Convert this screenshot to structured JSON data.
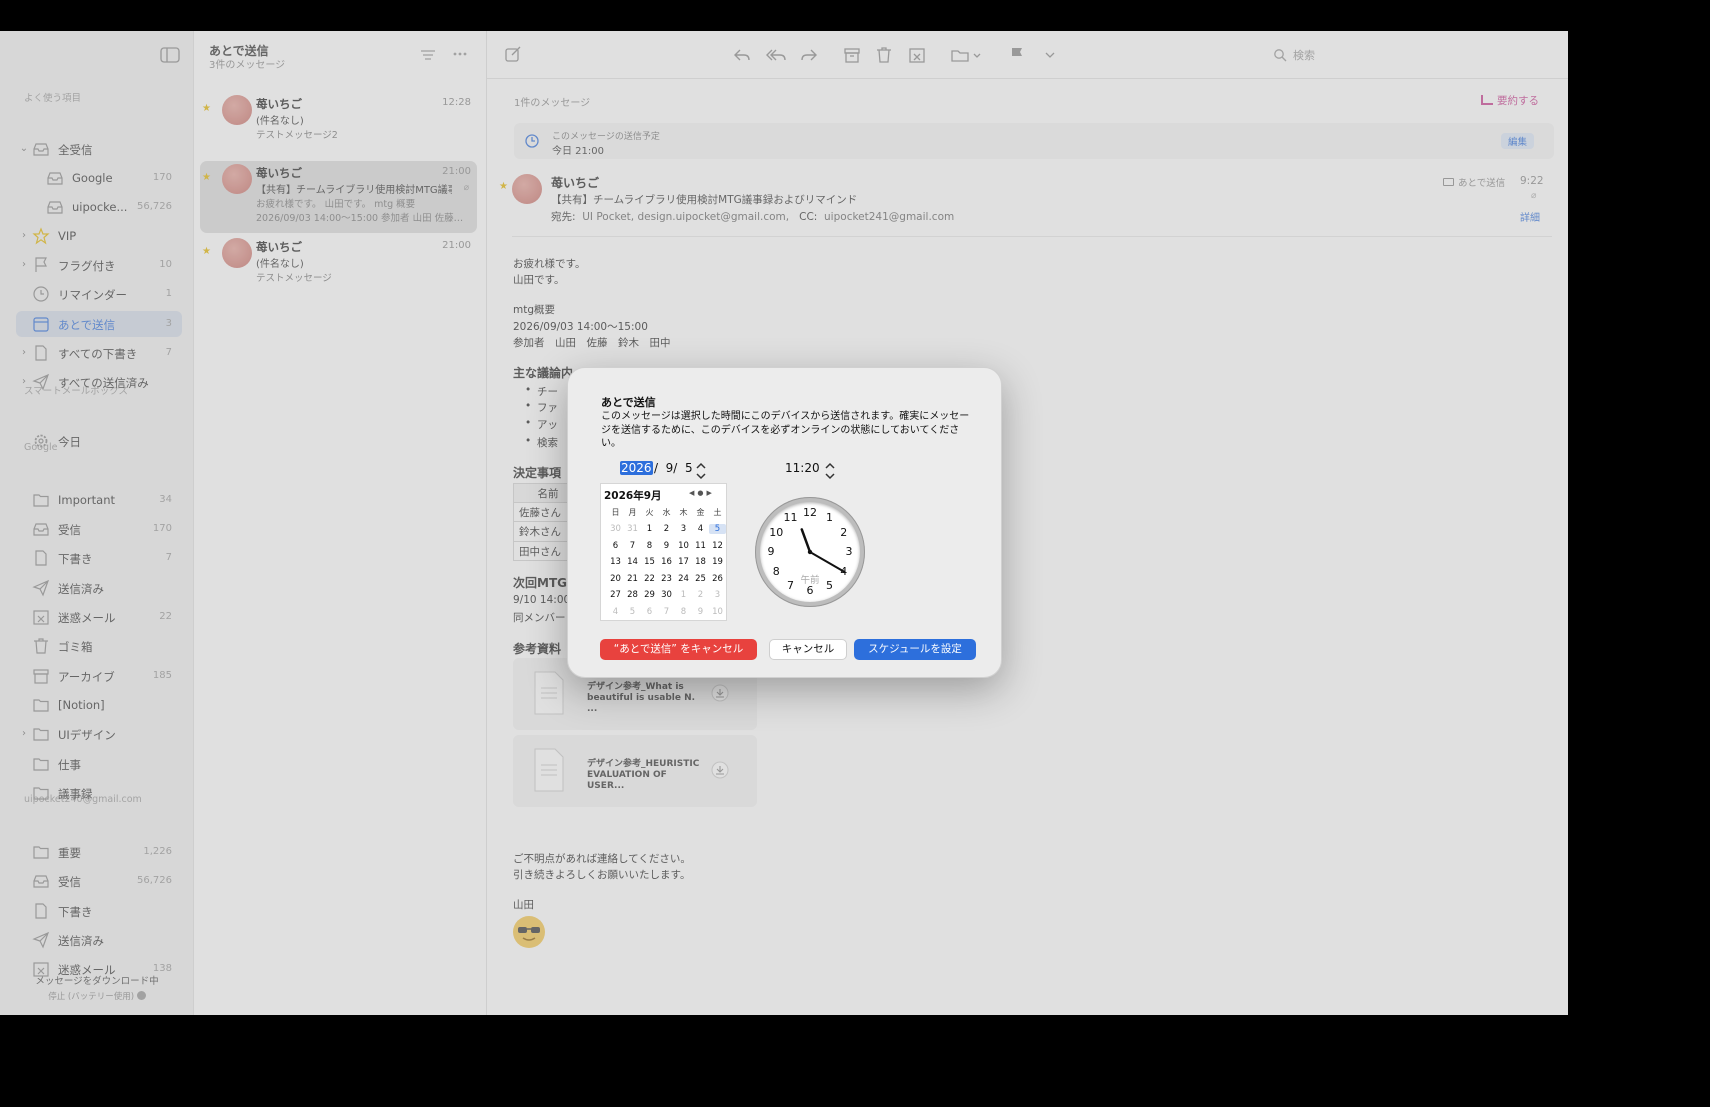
{
  "sidebar": {
    "sections": {
      "favorites": "よく使う項目",
      "smart": "スマートメールボックス",
      "google": "Google",
      "account": "uipocket240@gmail.com"
    },
    "favorites": [
      {
        "label": "全受信",
        "count": "",
        "icon": "inbox-icon"
      },
      {
        "label": "Google",
        "count": "170",
        "icon": "inbox-icon"
      },
      {
        "label": "uipocke...",
        "count": "56,726",
        "icon": "inbox-icon"
      },
      {
        "label": "VIP",
        "count": "",
        "icon": "star-icon"
      },
      {
        "label": "フラグ付き",
        "count": "10",
        "icon": "flag-icon"
      },
      {
        "label": "リマインダー",
        "count": "1",
        "icon": "clock-icon"
      },
      {
        "label": "あとで送信",
        "count": "3",
        "icon": "calendar-icon"
      },
      {
        "label": "すべての下書き",
        "count": "7",
        "icon": "document-icon"
      },
      {
        "label": "すべての送信済み",
        "count": "",
        "icon": "paperplane-icon"
      }
    ],
    "smart": [
      {
        "label": "今日",
        "count": "",
        "icon": "gear-icon"
      }
    ],
    "google": [
      {
        "label": "Important",
        "count": "34",
        "icon": "folder-icon"
      },
      {
        "label": "受信",
        "count": "170",
        "icon": "inbox-icon"
      },
      {
        "label": "下書き",
        "count": "7",
        "icon": "document-icon"
      },
      {
        "label": "送信済み",
        "count": "",
        "icon": "paperplane-icon"
      },
      {
        "label": "迷惑メール",
        "count": "22",
        "icon": "junk-icon"
      },
      {
        "label": "ゴミ箱",
        "count": "",
        "icon": "trash-icon"
      },
      {
        "label": "アーカイブ",
        "count": "185",
        "icon": "archive-icon"
      },
      {
        "label": "[Notion]",
        "count": "",
        "icon": "folder-icon"
      },
      {
        "label": "UIデザイン",
        "count": "",
        "icon": "folder-icon"
      },
      {
        "label": "仕事",
        "count": "",
        "icon": "folder-icon"
      },
      {
        "label": "議事録",
        "count": "",
        "icon": "folder-icon"
      }
    ],
    "account": [
      {
        "label": "重要",
        "count": "1,226",
        "icon": "folder-icon"
      },
      {
        "label": "受信",
        "count": "56,726",
        "icon": "inbox-icon"
      },
      {
        "label": "下書き",
        "count": "",
        "icon": "document-icon"
      },
      {
        "label": "送信済み",
        "count": "",
        "icon": "paperplane-icon"
      },
      {
        "label": "迷惑メール",
        "count": "138",
        "icon": "junk-icon"
      }
    ],
    "footer": {
      "status": "メッセージをダウンロード中",
      "sub": "停止 (バッテリー使用)"
    }
  },
  "list": {
    "title": "あとで送信",
    "subtitle": "3件のメッセージ",
    "messages": [
      {
        "from": "苺いちご",
        "time": "12:28",
        "subject": "(件名なし)",
        "preview": "テストメッセージ2",
        "preview2": ""
      },
      {
        "from": "苺いちご",
        "time": "21:00",
        "subject": "【共有】チームライブラリ使用検討MTG議事…",
        "preview": "お疲れ様です。 山田です。 mtg 概要",
        "preview2": "2026/09/03 14:00～15:00 参加者 山田 佐藤…"
      },
      {
        "from": "苺いちご",
        "time": "21:00",
        "subject": "(件名なし)",
        "preview": "テストメッセージ",
        "preview2": ""
      }
    ]
  },
  "viewer": {
    "search_placeholder": "検索",
    "count": "1件のメッセージ",
    "summarize": "要約する",
    "schedule": {
      "label": "このメッセージの送信予定",
      "value": "今日 21:00",
      "edit": "編集"
    },
    "header": {
      "from": "苺いちご",
      "subject": "【共有】チームライブラリ使用検討MTG議事録およびリマインド",
      "to_label": "宛先:",
      "to": "UI Pocket,  design.uipocket@gmail.com,",
      "cc_label": "CC:",
      "cc": "uipocket241@gmail.com",
      "folder": "あとで送信",
      "time": "9:22",
      "detail": "詳細"
    },
    "body": {
      "greeting1": "お疲れ様です。",
      "greeting2": "山田です。",
      "summary_title": "mtg概要",
      "datetime": "2026/09/03 14:00～15:00",
      "attendees": "参加者　山田　佐藤　鈴木　田中",
      "agenda_title": "主な議論内",
      "agenda_items": [
        "チー",
        "ファ",
        "アッ",
        "検索"
      ],
      "decisions_title": "決定事項",
      "table_header": "名前",
      "table_rows": [
        "佐藤さん",
        "鈴木さん",
        "田中さん"
      ],
      "next_title": "次回MTG",
      "next_line1": "9/10 14:00",
      "next_line2": "同メンバー",
      "refs_title": "参考資料",
      "attachments": [
        {
          "name": "デザイン参考_What is beautiful is usable N. ..."
        },
        {
          "name": "デザイン参考_HEURISTIC EVALUATION OF USER..."
        }
      ],
      "closing1": "ご不明点があれば連絡してください。",
      "closing2": "引き続きよろしくお願いいたします。",
      "signature": "山田"
    }
  },
  "dialog": {
    "title": "あとで送信",
    "description": "このメッセージは選択した時間にこのデバイスから送信されます。確実にメッセージを送信するために、このデバイスを必ずオンラインの状態にしておいてください。",
    "date_year": "2026",
    "date_rest": "/  9/  5",
    "time": "11:20",
    "calendar": {
      "month_title": "2026年9月",
      "weekdays": [
        "日",
        "月",
        "火",
        "水",
        "木",
        "金",
        "土"
      ],
      "weeks": [
        [
          "30",
          "31",
          "1",
          "2",
          "3",
          "4",
          "5"
        ],
        [
          "6",
          "7",
          "8",
          "9",
          "10",
          "11",
          "12"
        ],
        [
          "13",
          "14",
          "15",
          "16",
          "17",
          "18",
          "19"
        ],
        [
          "20",
          "21",
          "22",
          "23",
          "24",
          "25",
          "26"
        ],
        [
          "27",
          "28",
          "29",
          "30",
          "1",
          "2",
          "3"
        ],
        [
          "4",
          "5",
          "6",
          "7",
          "8",
          "9",
          "10"
        ]
      ],
      "selected_day": "5"
    },
    "clock": {
      "numbers": [
        "12",
        "1",
        "2",
        "3",
        "4",
        "5",
        "6",
        "7",
        "8",
        "9",
        "10",
        "11"
      ],
      "ampm": "午前",
      "hour": 11,
      "minute": 20
    },
    "buttons": {
      "cancel_schedule": "“あとで送信” をキャンセル",
      "cancel": "キャンセル",
      "set_schedule": "スケジュールを設定"
    }
  },
  "colors": {
    "accent": "#2d6fdc",
    "danger": "#e8423e",
    "summarize": "#c93f90",
    "selection": "#d4dcea"
  }
}
